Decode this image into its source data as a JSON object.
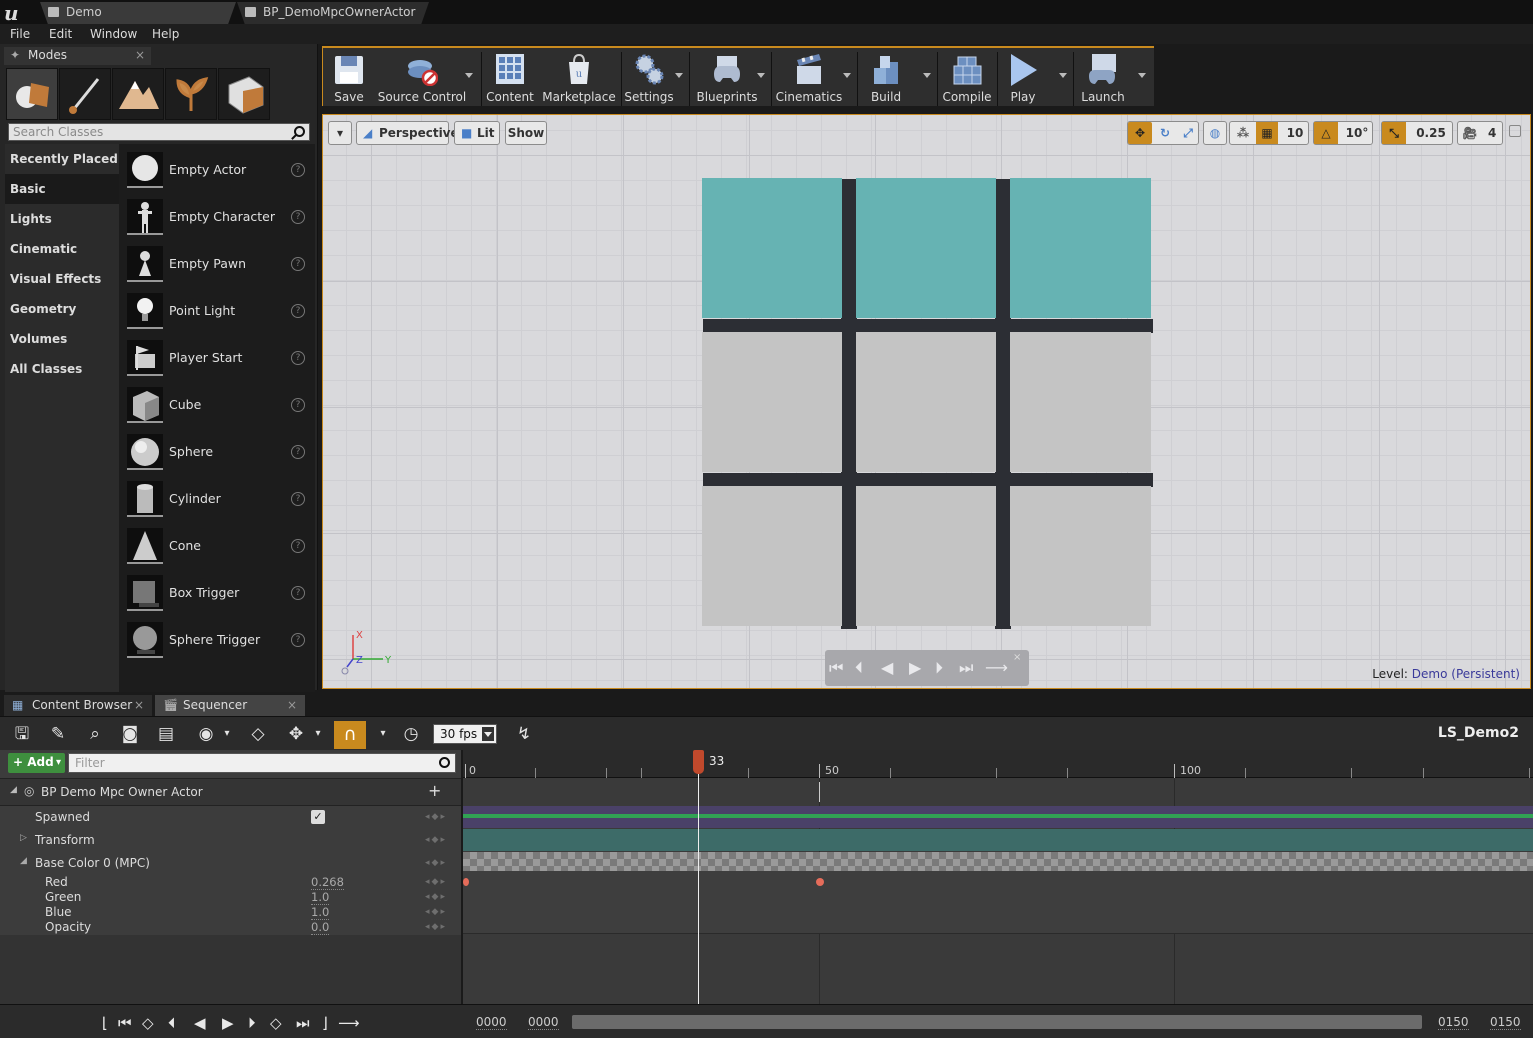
{
  "app": {
    "tabs": [
      {
        "label": "Demo"
      },
      {
        "label": "BP_DemoMpcOwnerActor"
      }
    ],
    "menu": [
      "File",
      "Edit",
      "Window",
      "Help"
    ]
  },
  "modes_panel": {
    "title": "Modes",
    "search_placeholder": "Search Classes",
    "categories": [
      "Recently Placed",
      "Basic",
      "Lights",
      "Cinematic",
      "Visual Effects",
      "Geometry",
      "Volumes",
      "All Classes"
    ],
    "active_category": "Basic",
    "items": [
      "Empty Actor",
      "Empty Character",
      "Empty Pawn",
      "Point Light",
      "Player Start",
      "Cube",
      "Sphere",
      "Cylinder",
      "Cone",
      "Box Trigger",
      "Sphere Trigger"
    ]
  },
  "toolbar": {
    "buttons": [
      {
        "label": "Save",
        "icon": "floppy-disk-icon"
      },
      {
        "label": "Source Control",
        "icon": "source-control-icon"
      },
      {
        "label": "Content",
        "icon": "content-grid-icon"
      },
      {
        "label": "Marketplace",
        "icon": "marketplace-bag-icon"
      },
      {
        "label": "Settings",
        "icon": "gears-icon"
      },
      {
        "label": "Blueprints",
        "icon": "gamepad-icon"
      },
      {
        "label": "Cinematics",
        "icon": "clapperboard-icon"
      },
      {
        "label": "Build",
        "icon": "build-blocks-icon"
      },
      {
        "label": "Compile",
        "icon": "compile-cubes-icon"
      },
      {
        "label": "Play",
        "icon": "play-icon"
      },
      {
        "label": "Launch",
        "icon": "launch-gamepad-icon"
      }
    ]
  },
  "viewport": {
    "view_mode": "Perspective",
    "lighting": "Lit",
    "show_label": "Show",
    "grid_snap": "10",
    "rotation_snap": "10°",
    "scale_snap": "0.25",
    "camera_speed": "4",
    "level_label": "Level:",
    "level_name": "Demo (Persistent)",
    "axis_labels": {
      "x": "X",
      "y": "Y",
      "z": "Z"
    },
    "colors": {
      "teal_cube": "#66b3b3",
      "grey_cube": "#c4c4c4",
      "background": "#d9d9dc"
    }
  },
  "bottom_tabs": [
    {
      "label": "Content Browser"
    },
    {
      "label": "Sequencer"
    }
  ],
  "sequencer": {
    "fps": "30 fps",
    "sequence_name": "LS_Demo2",
    "add_label": "+ Add",
    "filter_placeholder": "Filter",
    "tracks": {
      "actor": "BP Demo Mpc Owner Actor",
      "spawned": "Spawned",
      "transform": "Transform",
      "base_color": "Base Color 0 (MPC)",
      "channels": [
        {
          "name": "Red",
          "value": "0.268"
        },
        {
          "name": "Green",
          "value": "1.0"
        },
        {
          "name": "Blue",
          "value": "1.0"
        },
        {
          "name": "Opacity",
          "value": "0.0"
        }
      ]
    },
    "ruler": {
      "labels": [
        "0",
        "50",
        "100"
      ],
      "playhead": "33"
    },
    "timecodes": {
      "start_view": "0000",
      "start_play": "0000",
      "end_play": "0150",
      "end_view": "0150"
    }
  }
}
